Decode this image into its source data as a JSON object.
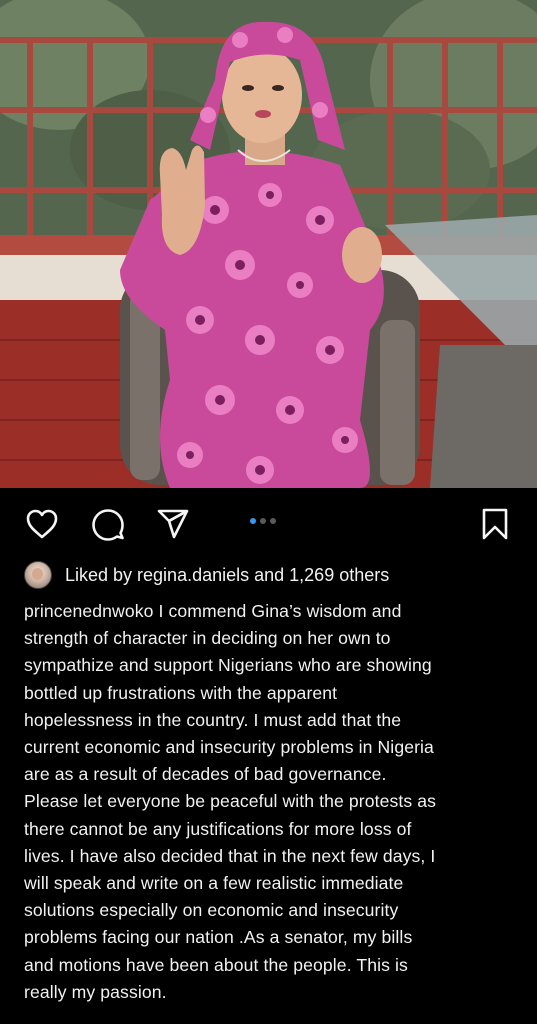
{
  "post": {
    "image_alt": "Woman in pink floral dress and matching headscarf seated in wicker chair, speaking with raised hand",
    "carousel": {
      "count": 3,
      "active_index": 0
    }
  },
  "actions": {
    "like_icon": "heart-icon",
    "comment_icon": "comment-bubble-icon",
    "share_icon": "paper-plane-icon",
    "save_icon": "bookmark-icon"
  },
  "likes": {
    "text": "Liked by regina.daniels and 1,269 others"
  },
  "caption": {
    "lines": [
      "princenednwoko I commend Gina’s wisdom and",
      "strength of character in deciding on her own to",
      "sympathize and support Nigerians who are showing",
      "bottled up frustrations with the apparent",
      "hopelessness in the country. I must add that the",
      "current economic and insecurity problems in Nigeria",
      "are as a result of decades of bad governance.",
      "Please let everyone be  peaceful with the protests as",
      "there cannot be any justifications for more loss of",
      "lives. I have also decided that in the next few days, I",
      "will speak and write on  a few realistic immediate",
      "solutions especially on economic and insecurity",
      "problems facing our nation .As a senator, my bills",
      "and motions have been about the people. This is",
      "really my passion."
    ]
  },
  "colors": {
    "background": "#000000",
    "text": "#f2f2f2",
    "dot_active": "#3897f0",
    "dot_inactive": "#5a5a5a"
  }
}
